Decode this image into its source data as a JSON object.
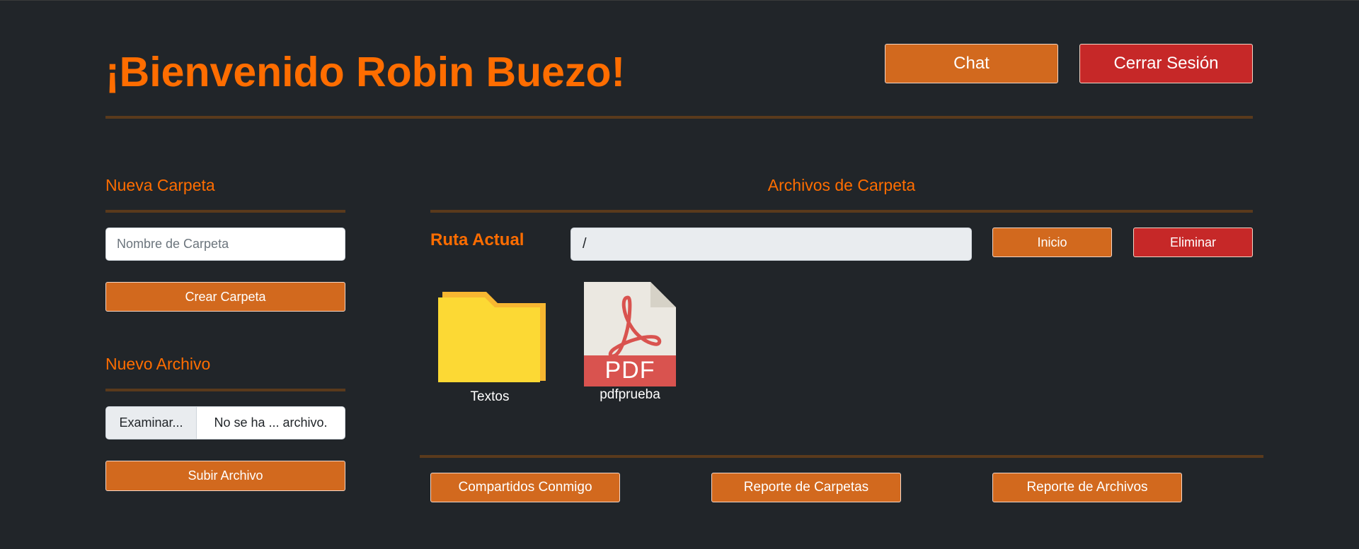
{
  "header": {
    "welcome": "¡Bienvenido Robin Buezo!",
    "chat_label": "Chat",
    "logout_label": "Cerrar Sesión"
  },
  "new_folder": {
    "title": "Nueva Carpeta",
    "placeholder": "Nombre de Carpeta",
    "create_label": "Crear Carpeta"
  },
  "new_file": {
    "title": "Nuevo Archivo",
    "browse_label": "Examinar...",
    "file_status": "No se ha ... archivo.",
    "upload_label": "Subir Archivo"
  },
  "folder_files": {
    "title": "Archivos de Carpeta",
    "path_label": "Ruta Actual",
    "path_value": "/",
    "home_label": "Inicio",
    "delete_label": "Eliminar",
    "items": [
      {
        "name": "Textos",
        "type": "folder",
        "icon": "folder-icon"
      },
      {
        "name": "pdfprueba",
        "type": "pdf",
        "icon": "pdf-file-icon",
        "badge": "PDF"
      }
    ]
  },
  "footer": {
    "shared_label": "Compartidos Conmigo",
    "folders_report_label": "Reporte de Carpetas",
    "files_report_label": "Reporte de Archivos"
  },
  "colors": {
    "background": "#212529",
    "accent": "#ff6d00",
    "button_orange": "#d2691e",
    "button_red": "#c62828",
    "rule": "#5a3a1c"
  }
}
